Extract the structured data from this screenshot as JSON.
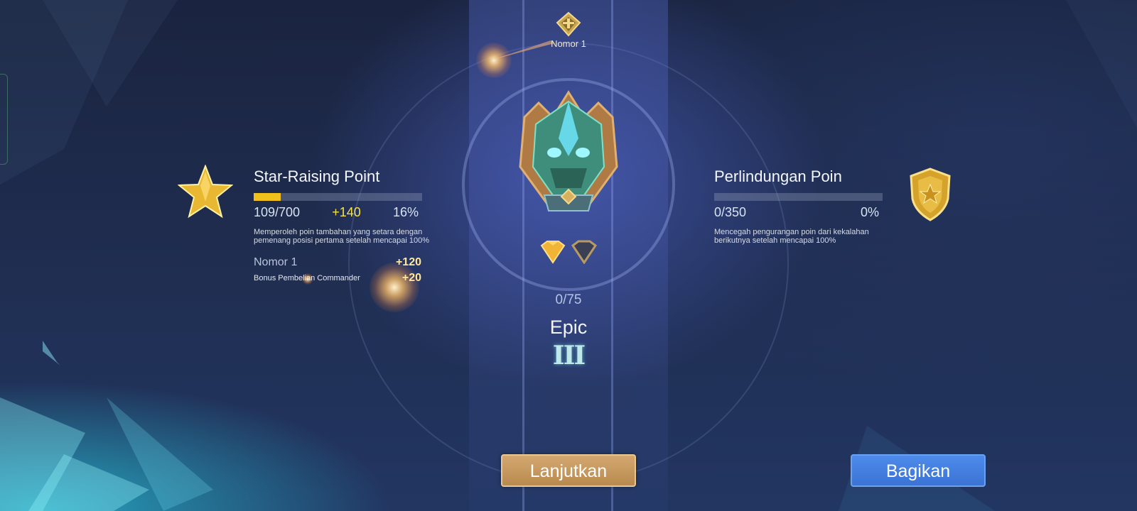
{
  "top_rank": {
    "label": "Nomor 1",
    "icon": "crown-emblem-icon"
  },
  "rank": {
    "emblem": "epic-rank-emblem-icon",
    "progress": "0/75",
    "name": "Epic",
    "tier": "III",
    "stars_total": 2,
    "stars_filled": 1
  },
  "star_raising": {
    "icon": "star-icon",
    "title": "Star-Raising Point",
    "progress": 0.16,
    "value_text": "109/700",
    "gain_text": "+140",
    "percent_text": "16%",
    "description": "Memperoleh poin tambahan yang setara dengan pemenang posisi pertama setelah mencapai 100%",
    "bonuses": [
      {
        "label": "Nomor 1",
        "value": "+120"
      },
      {
        "label": "Bonus Pembelian Commander",
        "value": "+20"
      }
    ]
  },
  "protection": {
    "icon": "shield-star-icon",
    "title": "Perlindungan Poin",
    "progress": 0,
    "value_text": "0/350",
    "percent_text": "0%",
    "description": "Mencegah pengurangan poin dari kekalahan berikutnya setelah mencapai 100%"
  },
  "buttons": {
    "continue": "Lanjutkan",
    "share": "Bagikan"
  },
  "colors": {
    "bar_fill": "#f0c11c",
    "continue_button": "#c79b5f",
    "share_button": "#4580e0",
    "gain_text": "#f6e24a"
  }
}
